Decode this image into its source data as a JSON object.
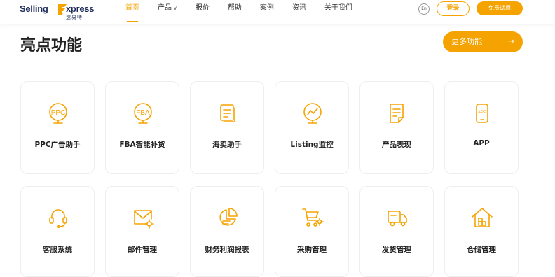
{
  "header": {
    "logo_text_left": "Selling",
    "logo_text_right": "xpress",
    "logo_sub": "速易特",
    "nav": [
      {
        "label": "首页",
        "active": true
      },
      {
        "label": "产品",
        "has_dropdown": true
      },
      {
        "label": "报价"
      },
      {
        "label": "帮助"
      },
      {
        "label": "案例"
      },
      {
        "label": "资讯"
      },
      {
        "label": "关于我们"
      }
    ],
    "lang": "En",
    "login_label": "登录",
    "trial_label": "免费试用"
  },
  "section": {
    "title": "亮点功能",
    "more_label": "更多功能",
    "more_arrow": "→"
  },
  "features": [
    {
      "label": "PPC广告助手",
      "icon": "ppc-icon",
      "icon_text": "PPC"
    },
    {
      "label": "FBA智能补货",
      "icon": "fba-icon",
      "icon_text": "FBA"
    },
    {
      "label": "海卖助手",
      "icon": "document-stack-icon"
    },
    {
      "label": "Listing监控",
      "icon": "monitor-chart-icon"
    },
    {
      "label": "产品表现",
      "icon": "report-icon"
    },
    {
      "label": "APP",
      "icon": "mobile-app-icon",
      "icon_text": "APP"
    },
    {
      "label": "客服系统",
      "icon": "headset-icon"
    },
    {
      "label": "邮件管理",
      "icon": "mail-gear-icon"
    },
    {
      "label": "财务利润报表",
      "icon": "pie-chart-report-icon"
    },
    {
      "label": "采购管理",
      "icon": "cart-gear-icon"
    },
    {
      "label": "发货管理",
      "icon": "truck-icon"
    },
    {
      "label": "仓储管理",
      "icon": "warehouse-icon"
    }
  ],
  "colors": {
    "accent": "#f5a300",
    "brand_dark": "#1f2d5c"
  }
}
